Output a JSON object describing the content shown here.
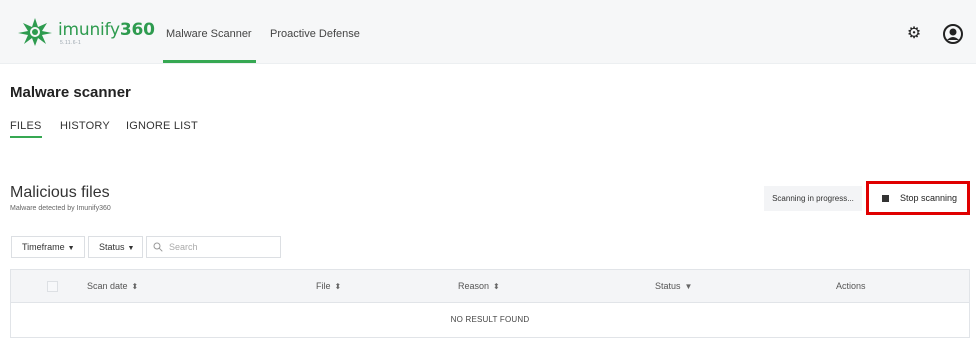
{
  "header": {
    "logo_name_light": "imunify",
    "logo_name_bold": "360",
    "logo_version": "5.11.6-1",
    "tabs": [
      {
        "label": "Malware Scanner",
        "active": true
      },
      {
        "label": "Proactive Defense",
        "active": false
      }
    ],
    "brand_color": "#2e9b4f",
    "accent_color": "#36a852"
  },
  "page": {
    "title": "Malware scanner",
    "sub_tabs": [
      {
        "label": "FILES",
        "active": true
      },
      {
        "label": "HISTORY",
        "active": false
      },
      {
        "label": "IGNORE LIST",
        "active": false
      }
    ]
  },
  "section": {
    "title": "Malicious files",
    "subtitle": "Malware detected by Imunify360",
    "status_text": "Scanning in progress...",
    "stop_label": "Stop scanning",
    "highlight_color": "#e00000"
  },
  "filters": {
    "timeframe": "Timeframe",
    "status": "Status",
    "search_placeholder": "Search"
  },
  "table": {
    "columns": [
      "Scan date",
      "File",
      "Reason",
      "Status",
      "Actions"
    ],
    "empty_message": "NO RESULT FOUND"
  }
}
